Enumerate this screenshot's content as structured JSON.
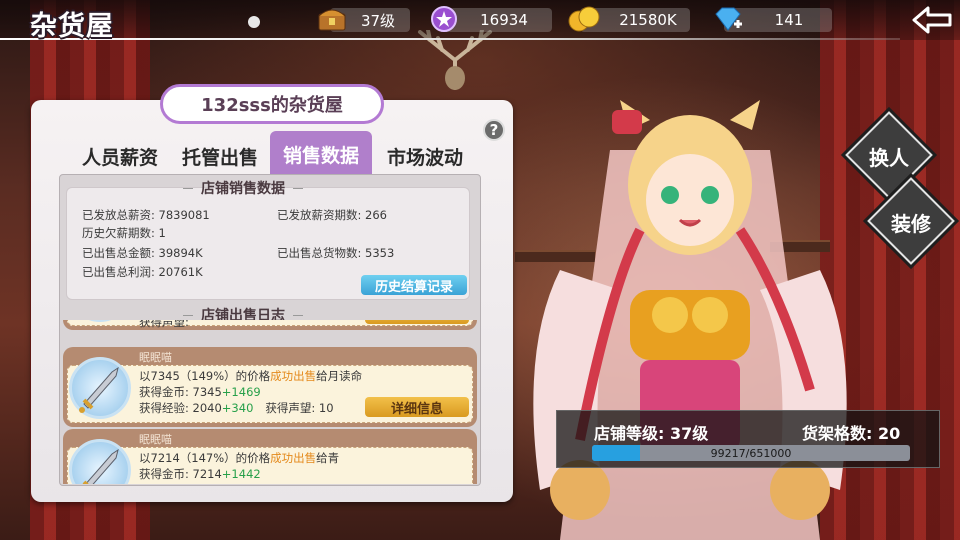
{
  "header": {
    "title": "杂货屋",
    "level": "37级",
    "purple_currency": "16934",
    "gold": "21580K",
    "diamonds": "141"
  },
  "shop": {
    "name": "132sss的杂货屋"
  },
  "tabs": [
    {
      "label": "人员薪资"
    },
    {
      "label": "托管出售"
    },
    {
      "label": "销售数据"
    },
    {
      "label": "市场波动"
    }
  ],
  "active_tab": "销售数据",
  "sales_data": {
    "heading": "店铺销售数据",
    "stats": [
      {
        "label": "已发放总薪资: ",
        "value": "7839081"
      },
      {
        "label": "已发放薪资期数: ",
        "value": "266"
      },
      {
        "label": "历史欠薪期数: ",
        "value": "1"
      },
      {
        "label": "已出售总金额: ",
        "value": "39894K"
      },
      {
        "label": "已出售总货物数: ",
        "value": "5353"
      },
      {
        "label": "已出售总利润: ",
        "value": "20761K"
      }
    ],
    "history_button": "历史结算记录"
  },
  "log": {
    "heading": "店铺出售日志",
    "partial_text": "获得声望:",
    "entries": [
      {
        "seller": "眠眠喵",
        "prefix": "以7345（149%）的价格",
        "action": "成功出售",
        "suffix": "给月读命",
        "gold_label": "获得金币:  7345",
        "gold_bonus": "+1469",
        "exp_label": "获得经验:  2040",
        "exp_bonus": "+340",
        "rep_label": "获得声望:  10",
        "detail_button": "详细信息"
      },
      {
        "seller": "眠眠喵",
        "prefix": "以7214（147%）的价格",
        "action": "成功出售",
        "suffix": "给青",
        "gold_label": "获得金币:  7214",
        "gold_bonus": "+1442"
      }
    ]
  },
  "side_buttons": {
    "change": "换人",
    "decorate": "装修"
  },
  "shop_level": {
    "level_text": "店铺等级: 37级",
    "shelf_text": "货架格数: 20",
    "progress_text": "99217/651000",
    "progress_fraction": 0.1524
  },
  "colors": {
    "accent_purple": "#b07fcb",
    "progress_blue": "#27a0e0",
    "highlight_orange": "#e48a1c",
    "bonus_green": "#27a04a"
  }
}
